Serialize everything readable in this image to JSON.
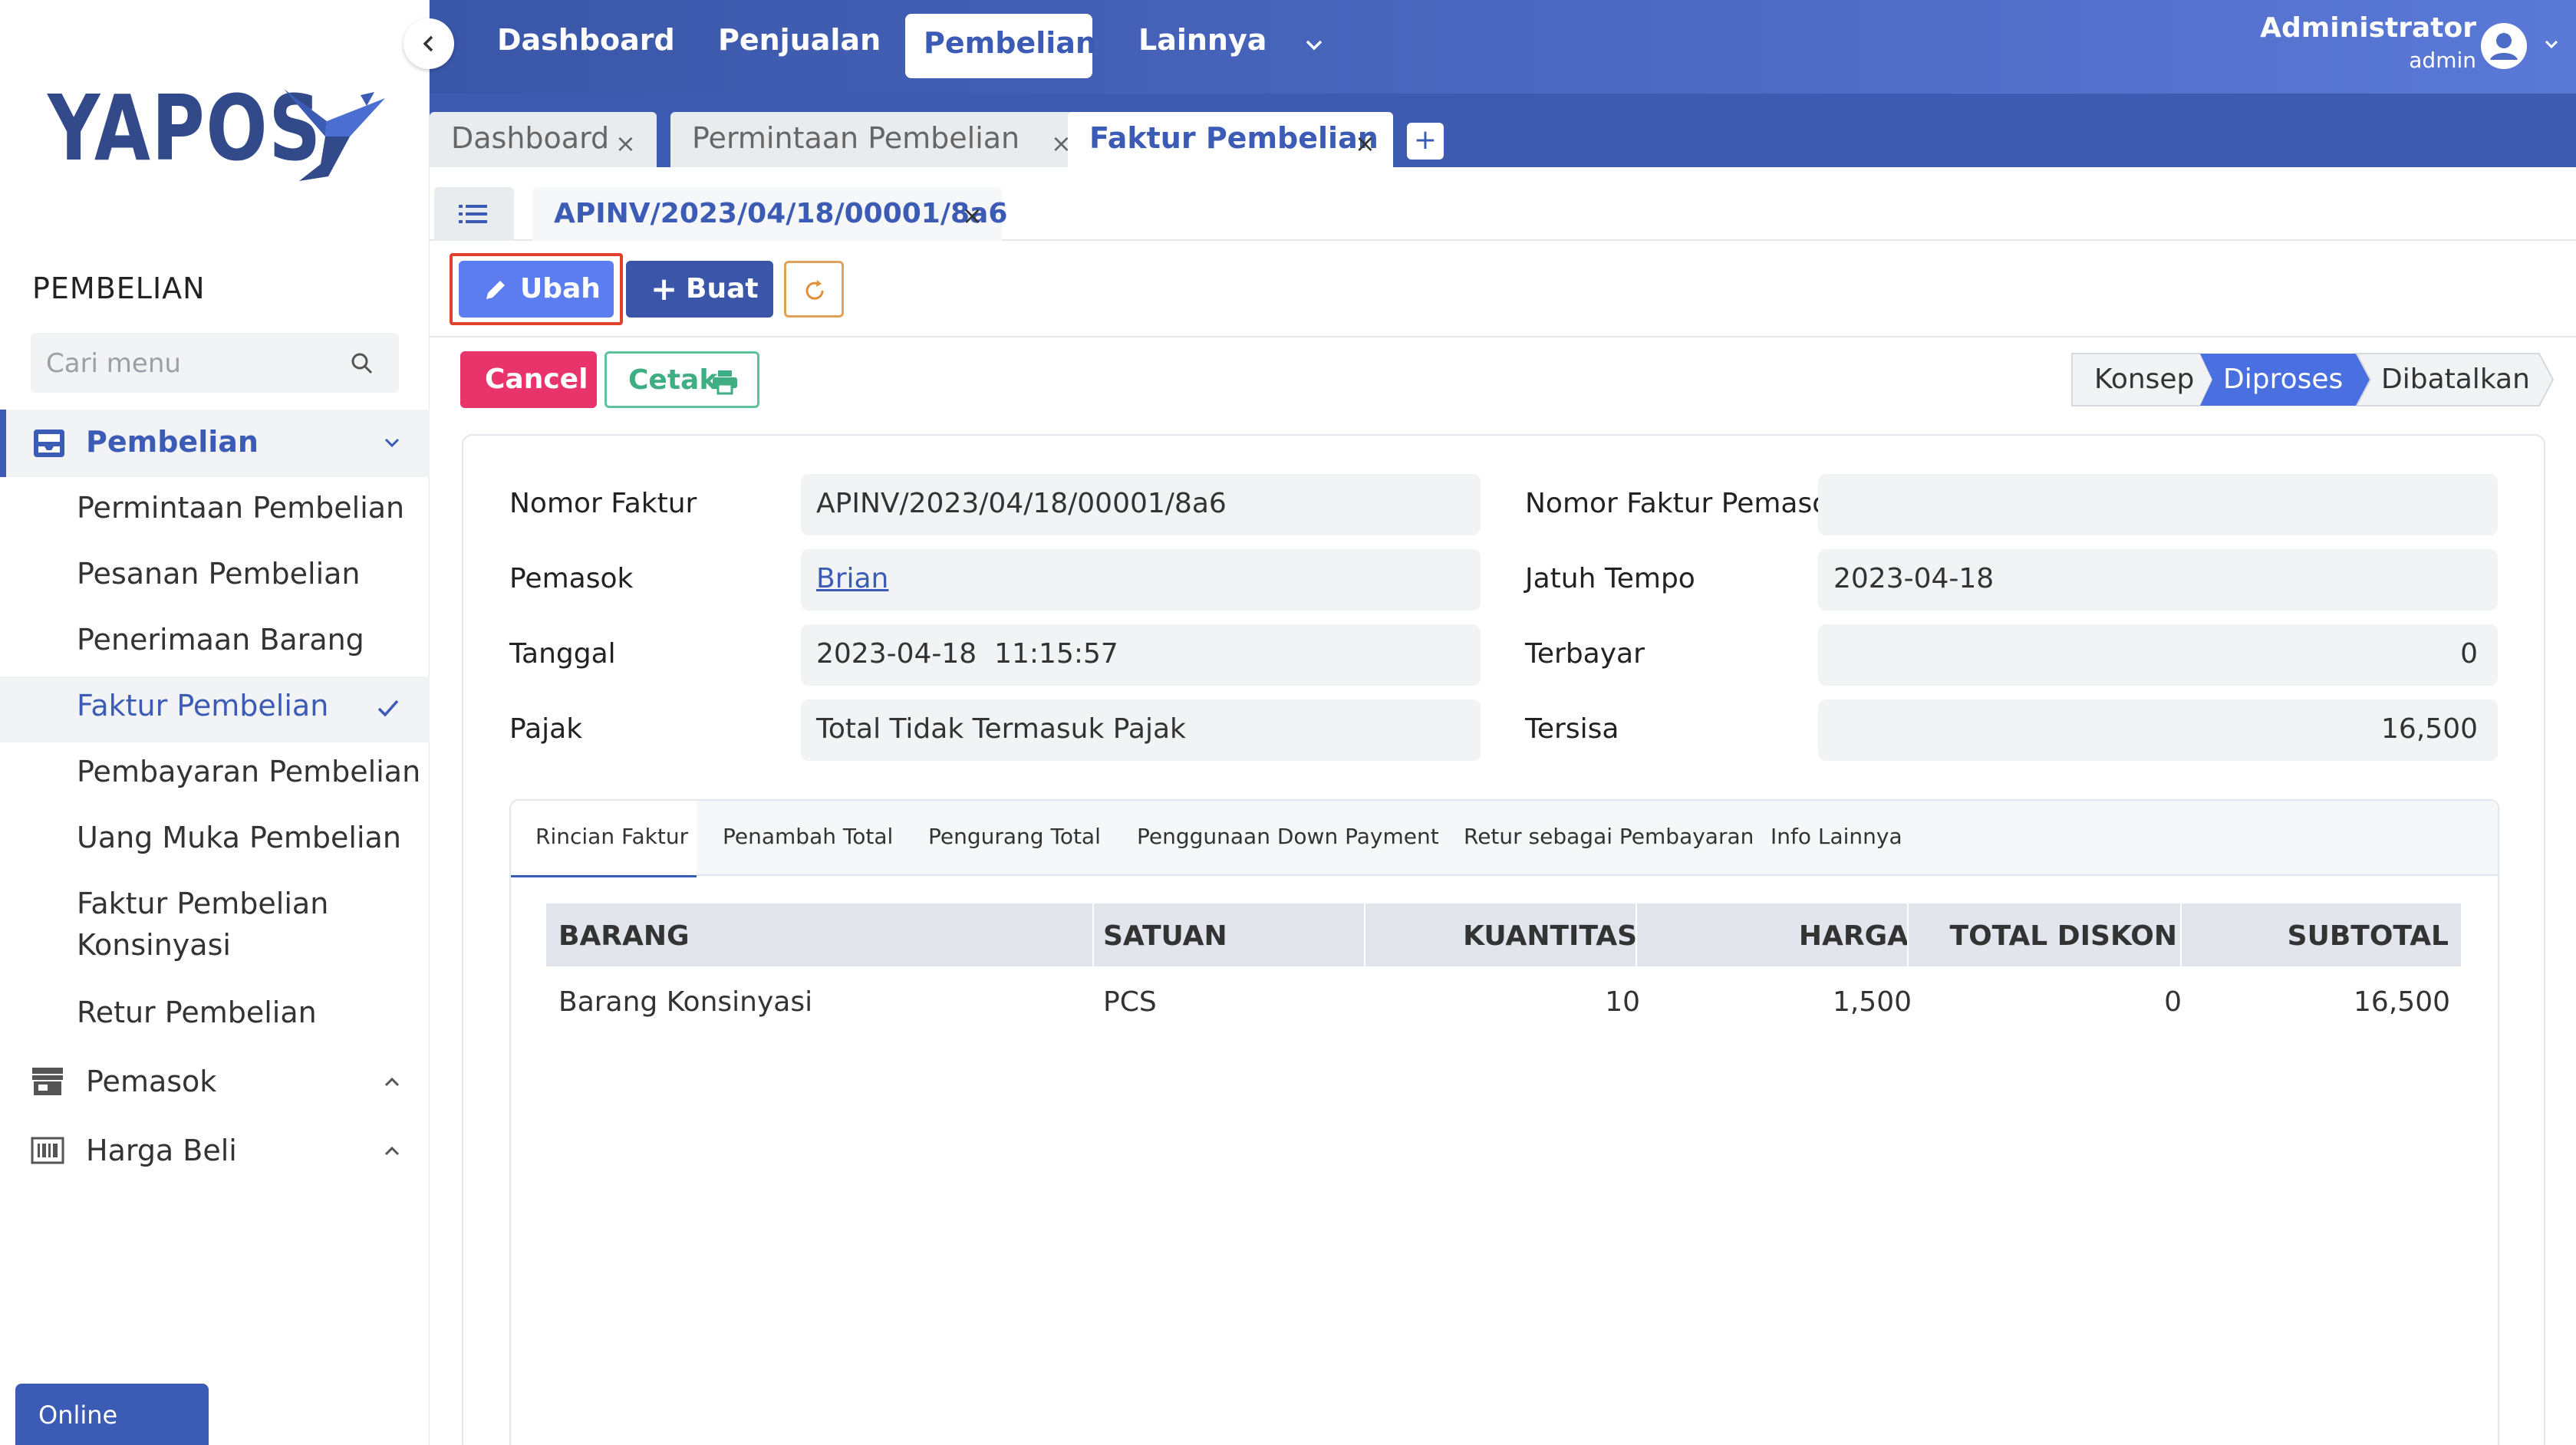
{
  "brand": {
    "logo_text": "YAPOS"
  },
  "sidebar": {
    "section_title": "PEMBELIAN",
    "search_placeholder": "Cari menu",
    "active_group": "Pembelian",
    "items": [
      "Permintaan Pembelian",
      "Pesanan Pembelian",
      "Penerimaan Barang",
      "Faktur Pembelian",
      "Pembayaran Pembelian",
      "Uang Muka Pembelian",
      "Faktur Pembelian",
      "Konsinyasi",
      "Retur Pembelian"
    ],
    "groups": [
      "Pemasok",
      "Harga Beli"
    ],
    "online_label": "Online"
  },
  "topnav": {
    "items": [
      "Dashboard",
      "Penjualan",
      "Pembelian",
      "Lainnya"
    ],
    "active": "Pembelian",
    "user_name": "Administrator",
    "user_role": "admin"
  },
  "window_tabs": [
    {
      "label": "Dashboard",
      "close": "×"
    },
    {
      "label": "Permintaan Pembelian",
      "close": "×"
    },
    {
      "label": "Faktur Pembelian",
      "close": "×"
    }
  ],
  "add_tab": "+",
  "doc_tab": {
    "label": "APINV/2023/04/18/00001/8a6",
    "close": "×"
  },
  "actions": {
    "edit": "Ubah",
    "create": "Buat",
    "cancel": "Cancel",
    "print": "Cetak"
  },
  "status_steps": [
    "Konsep",
    "Diproses",
    "Dibatalkan"
  ],
  "status_active": "Diproses",
  "form": {
    "left": [
      {
        "label": "Nomor Faktur",
        "value": "APINV/2023/04/18/00001/8a6"
      },
      {
        "label": "Pemasok",
        "value": "Brian"
      },
      {
        "label": "Tanggal",
        "value": "2023-04-18  11:15:57"
      },
      {
        "label": "Pajak",
        "value": "Total Tidak Termasuk Pajak"
      }
    ],
    "right": [
      {
        "label": "Nomor Faktur Pemasok",
        "value": ""
      },
      {
        "label": "Jatuh Tempo",
        "value": "2023-04-18"
      },
      {
        "label": "Terbayar",
        "value": "0"
      },
      {
        "label": "Tersisa",
        "value": "16,500"
      }
    ]
  },
  "detail_tabs": [
    "Rincian Faktur",
    "Penambah Total",
    "Pengurang Total",
    "Penggunaan Down Payment",
    "Retur sebagai Pembayaran",
    "Info Lainnya"
  ],
  "table": {
    "headers": [
      "BARANG",
      "SATUAN",
      "KUANTITAS",
      "HARGA",
      "TOTAL DISKON",
      "SUBTOTAL"
    ],
    "rows": [
      [
        "Barang Konsinyasi",
        "PCS",
        "10",
        "1,500",
        "0",
        "16,500"
      ]
    ]
  }
}
